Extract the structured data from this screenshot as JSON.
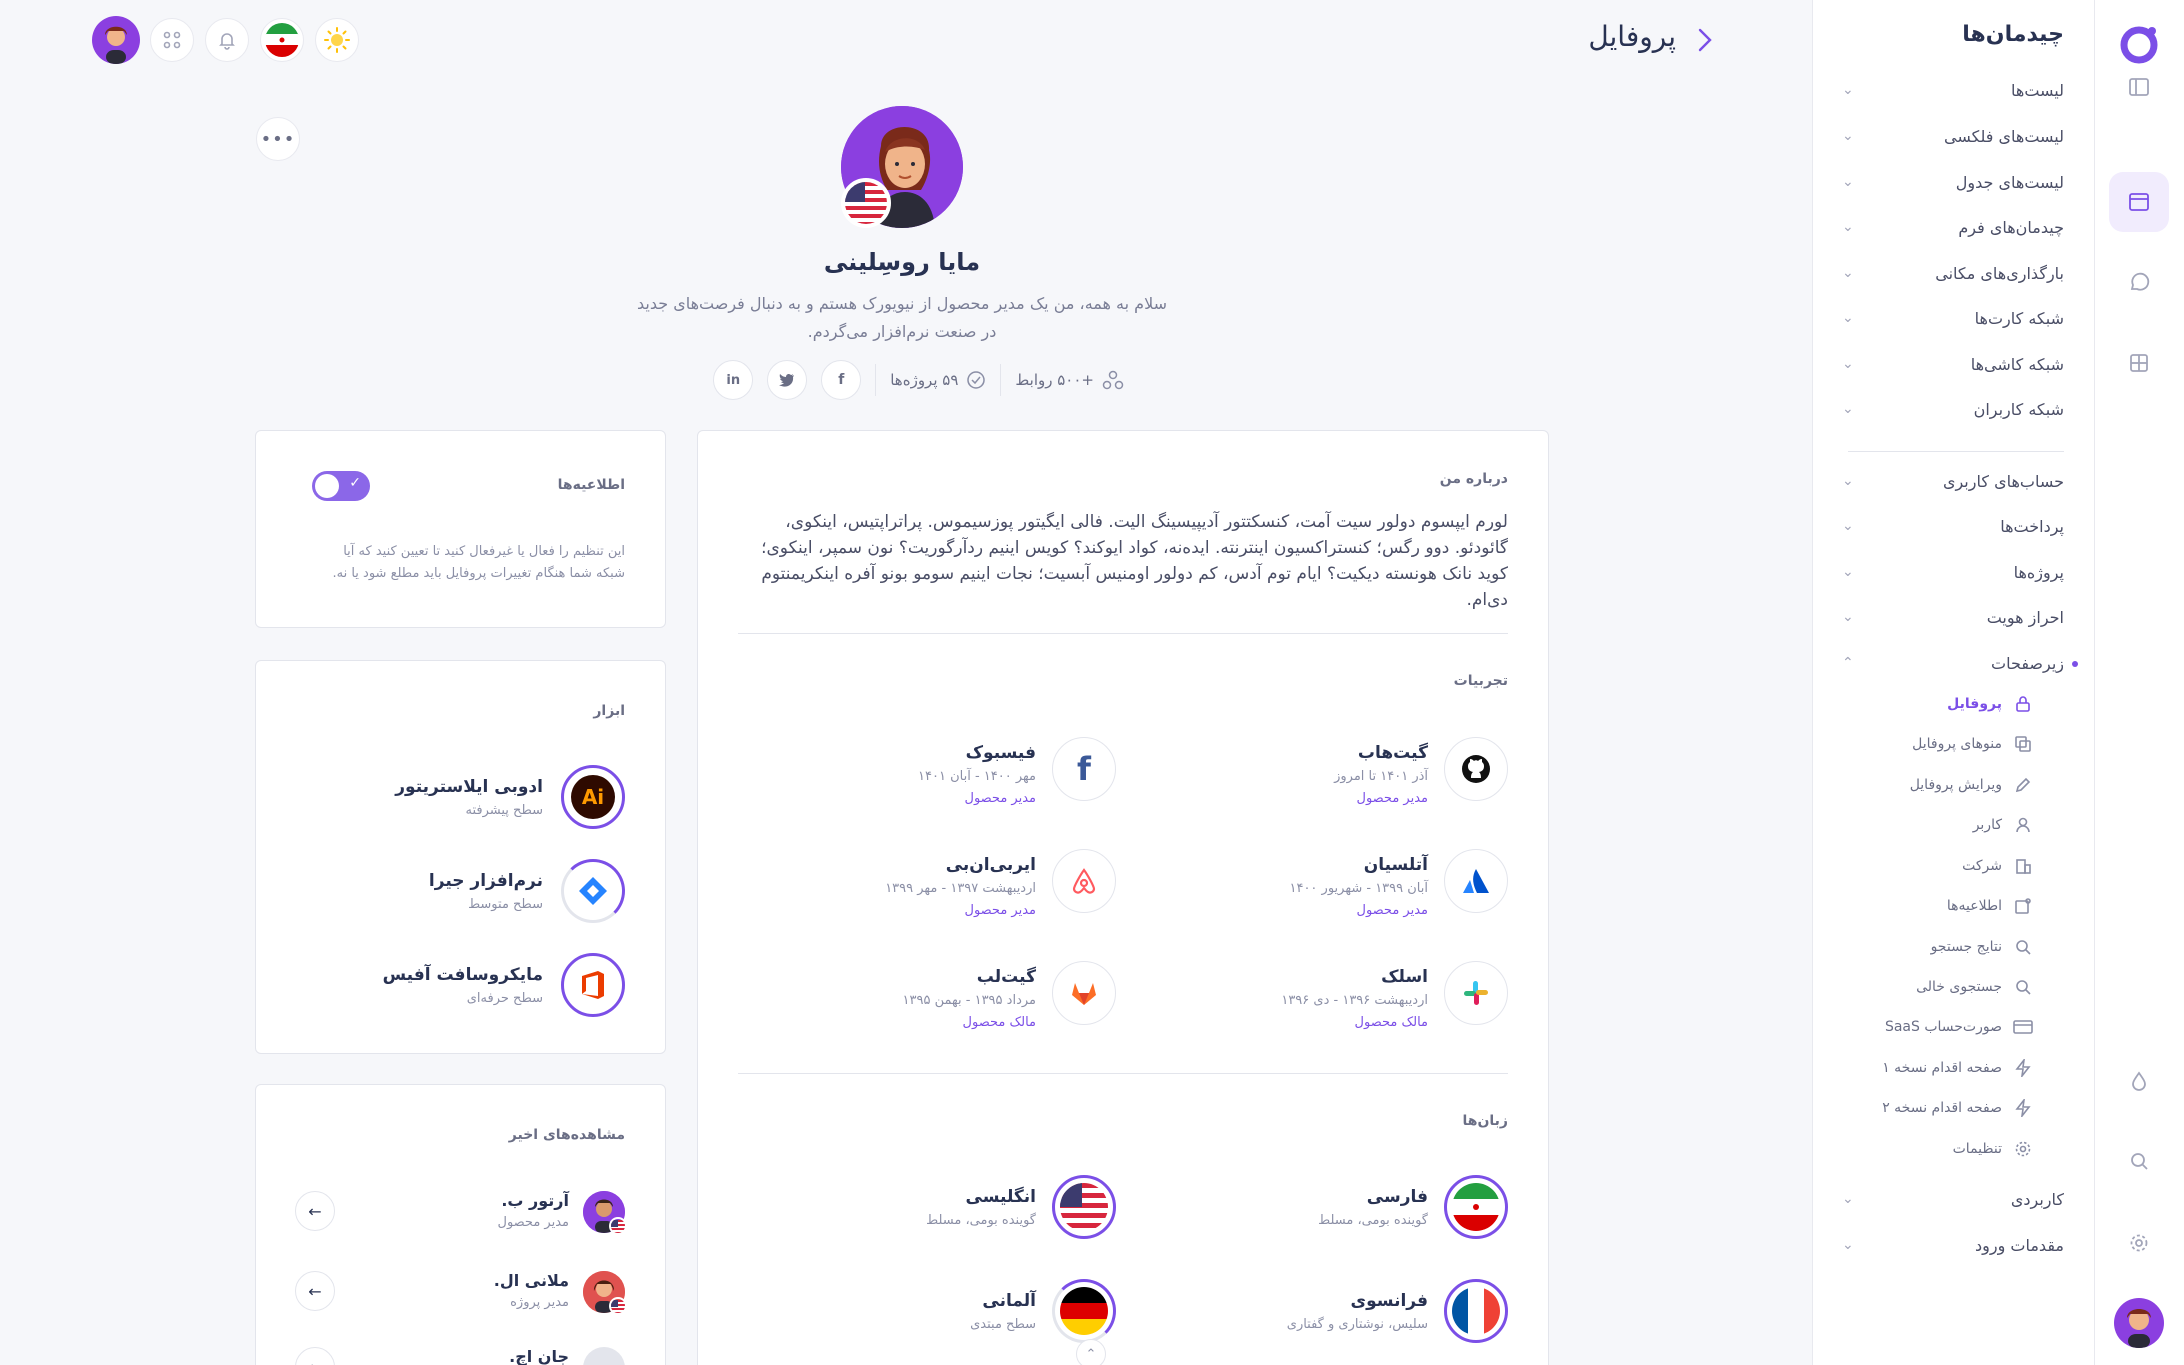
{
  "header": {
    "title": "پروفایل"
  },
  "sidebar": {
    "title": "چیدمان‌ها",
    "groups_top": [
      {
        "label": "لیست‌ها"
      },
      {
        "label": "لیست‌های فلکسی"
      },
      {
        "label": "لیست‌های جدول"
      },
      {
        "label": "چیدمان‌های فرم"
      },
      {
        "label": "بارگذاری‌های مکانی"
      },
      {
        "label": "شبکه کارت‌ها"
      },
      {
        "label": "شبکه کاشی‌ها"
      },
      {
        "label": "شبکه کاربران"
      }
    ],
    "groups_bottom": [
      {
        "label": "حساب‌های کاربری"
      },
      {
        "label": "پرداخت‌ها"
      },
      {
        "label": "پروژه‌ها"
      },
      {
        "label": "احراز هویت"
      },
      {
        "label": "زیرصفحات"
      }
    ],
    "subpages": [
      {
        "label": "پروفایل",
        "icon": "lock-icon"
      },
      {
        "label": "منوهای پروفایل",
        "icon": "copy-icon"
      },
      {
        "label": "ویرایش پروفایل",
        "icon": "pencil-icon"
      },
      {
        "label": "کاربر",
        "icon": "user-icon"
      },
      {
        "label": "شرکت",
        "icon": "building-icon"
      },
      {
        "label": "اطلاعیه‌ها",
        "icon": "notification-icon"
      },
      {
        "label": "نتایج جستجو",
        "icon": "search-icon"
      },
      {
        "label": "جستجوی خالی",
        "icon": "search-icon"
      },
      {
        "label": "صورت‌حساب SaaS",
        "icon": "credit-card-icon"
      },
      {
        "label": "صفحه اقدام نسخه ۱",
        "icon": "zap-icon"
      },
      {
        "label": "صفحه اقدام نسخه ۲",
        "icon": "zap-icon"
      },
      {
        "label": "تنظیمات",
        "icon": "gear-icon"
      }
    ],
    "groups_end": [
      {
        "label": "کاربردی"
      },
      {
        "label": "مقدمات ورود"
      }
    ]
  },
  "profile": {
    "name": "مایا روسِلینی",
    "bio_line1": "سلام به همه، من یک مدیر محصول از نیویورک هستم و به دنبال فرصت‌های جدید",
    "bio_line2": "در صنعت نرم‌افزار می‌گردم.",
    "connections": "+۵۰۰ روابط",
    "projects": "۵۹ پروژه‌ها"
  },
  "about": {
    "title": "درباره من",
    "text": "لورم ایپسوم دولور سیت آمت، کنسکتتور آدیپیسینگ الیت. فالی ایگیتور پوزسیموس. پراتراپتیس، اینکوی، گائودئو. دوو رگس؛ کنستراکسیون اینترنته. ایده‌نه، کواد ایوکند؟ کویس اینیم ردآرگوریت؟ نون سمپر، اینکوی؛ کوید نانک هونسته دیکیت؟ ایام توم آدس، کم دولور اومنیس آبسیت؛ نجات اینیم سومو بونو آفره اینکریمنتوم دی‌ام."
  },
  "experiences": {
    "title": "تجربیات",
    "items": [
      {
        "company": "گیت‌هاب",
        "period": "آذر ۱۴۰۱ تا امروز",
        "role": "مدیر محصول",
        "icon": "github-icon"
      },
      {
        "company": "فیسبوک",
        "period": "مهر ۱۴۰۰ - آبان ۱۴۰۱",
        "role": "مدیر محصول",
        "icon": "facebook-icon"
      },
      {
        "company": "آتلسیان",
        "period": "آبان ۱۳۹۹ - شهریور ۱۴۰۰",
        "role": "مدیر محصول",
        "icon": "atlassian-icon"
      },
      {
        "company": "ایربی‌ان‌بی",
        "period": "اردیبهشت ۱۳۹۷ - مهر ۱۳۹۹",
        "role": "مدیر محصول",
        "icon": "airbnb-icon"
      },
      {
        "company": "اسلک",
        "period": "اردیبهشت ۱۳۹۶ - دی ۱۳۹۶",
        "role": "مالک محصول",
        "icon": "slack-icon"
      },
      {
        "company": "گیت‌لب",
        "period": "مرداد ۱۳۹۵ - بهمن ۱۳۹۵",
        "role": "مالک محصول",
        "icon": "gitlab-icon"
      }
    ]
  },
  "languages": {
    "title": "زبان‌ها",
    "items": [
      {
        "name": "فارسی",
        "level": "گوینده بومی، مسلط",
        "icon": "iran-flag-icon"
      },
      {
        "name": "انگلیسی",
        "level": "گوینده بومی، مسلط",
        "icon": "us-flag-icon"
      },
      {
        "name": "فرانسوی",
        "level": "سلیس، نوشتاری و گفتاری",
        "icon": "france-flag-icon"
      },
      {
        "name": "آلمانی",
        "level": "سطح مبتدی",
        "icon": "germany-flag-icon"
      }
    ]
  },
  "notifications": {
    "title": "اطلاعیه‌ها",
    "text_line1": "این تنظیم را فعال یا غیرفعال کنید تا تعیین کنید که آیا",
    "text_line2": "شبکه شما هنگام تغییرات پروفایل باید مطلع شود یا نه.",
    "enabled": true
  },
  "tools": {
    "title": "ابزار",
    "items": [
      {
        "name": "ادوبی ایلاستریتور",
        "level": "سطح پیشرفته",
        "icon": "illustrator-icon"
      },
      {
        "name": "نرم‌افزار جیرا",
        "level": "سطح متوسط",
        "icon": "jira-icon"
      },
      {
        "name": "مایکروسافت آفیس",
        "level": "سطح حرفه‌ای",
        "icon": "office-icon"
      }
    ]
  },
  "recent_views": {
    "title": "مشاهده‌های اخیر",
    "items": [
      {
        "name": "آرتور ب.",
        "role": "مدیر محصول"
      },
      {
        "name": "ملانی ال.",
        "role": "مدیر پروژه"
      },
      {
        "name": "جان اچ."
      }
    ]
  },
  "colors": {
    "accent": "#7b4fe7",
    "background": "#f6f7fa"
  }
}
